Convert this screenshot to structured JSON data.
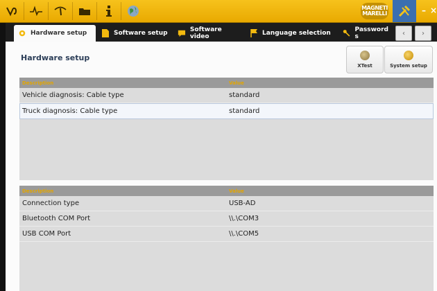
{
  "toolbar": {
    "icons": [
      "vehicle-icon",
      "diagnosis-icon",
      "gauge-icon",
      "folder-icon",
      "info-icon",
      "globe-icon"
    ],
    "brand_label": "MAGNETI MARELLI",
    "settings_icon": "tools-icon",
    "minimize_label": "–",
    "close_label": "×"
  },
  "tabs": [
    {
      "label": "Hardware setup",
      "icon": "gear-icon",
      "active": true
    },
    {
      "label": "Software setup",
      "icon": "document-icon",
      "active": false
    },
    {
      "label": "Software video",
      "icon": "chat-icon",
      "active": false
    },
    {
      "label": "Language selection",
      "icon": "flag-icon",
      "active": false
    },
    {
      "label": "Password s",
      "icon": "key-icon",
      "active": false
    }
  ],
  "nav": {
    "prev_label": "‹",
    "next_label": "›"
  },
  "page": {
    "title": "Hardware setup",
    "actions": [
      {
        "label": "XTest",
        "icon": "xtest-icon"
      },
      {
        "label": "System setup",
        "icon": "system-setup-icon"
      }
    ]
  },
  "grid1": {
    "headers": {
      "description": "Description",
      "value": "Value"
    },
    "rows": [
      {
        "description": "Vehicle diagnosis: Cable type",
        "value": "standard"
      },
      {
        "description": "Truck diagnosis: Cable type",
        "value": "standard"
      }
    ]
  },
  "grid2": {
    "headers": {
      "description": "Description",
      "value": "Value"
    },
    "rows": [
      {
        "description": "Connection type",
        "value": "USB-AD"
      },
      {
        "description": "Bluetooth COM Port",
        "value": "\\\\.\\COM3"
      },
      {
        "description": "USB COM Port",
        "value": "\\\\.\\COM5"
      }
    ]
  },
  "colors": {
    "accent": "#f2b90f",
    "active_tool": "#3b6fb0",
    "header_text": "#e3a600"
  }
}
